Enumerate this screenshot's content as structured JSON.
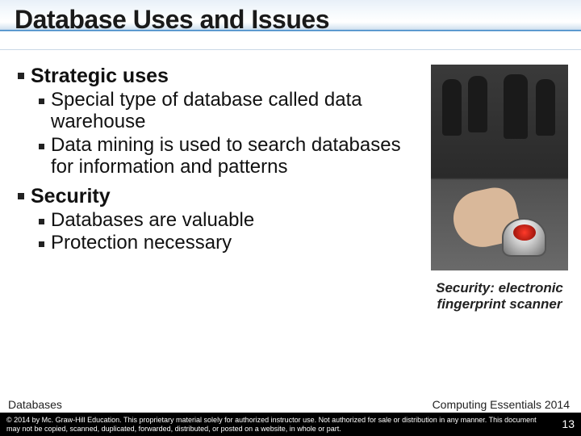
{
  "title": "Database Uses and Issues",
  "sections": [
    {
      "heading": "Strategic uses",
      "items": [
        "Special type of database called data warehouse",
        "Data mining is used to search databases for information and patterns"
      ]
    },
    {
      "heading": "Security",
      "items": [
        "Databases are valuable",
        "Protection necessary"
      ]
    }
  ],
  "figure": {
    "caption": "Security: electronic fingerprint scanner"
  },
  "footer": {
    "left": "Databases",
    "right": "Computing Essentials 2014",
    "copyright": "© 2014 by Mc. Graw-Hill Education. This proprietary material solely for authorized instructor use. Not authorized for sale or distribution in any manner. This document may not be copied, scanned, duplicated, forwarded, distributed, or posted on a website, in whole or part.",
    "page": "13"
  }
}
